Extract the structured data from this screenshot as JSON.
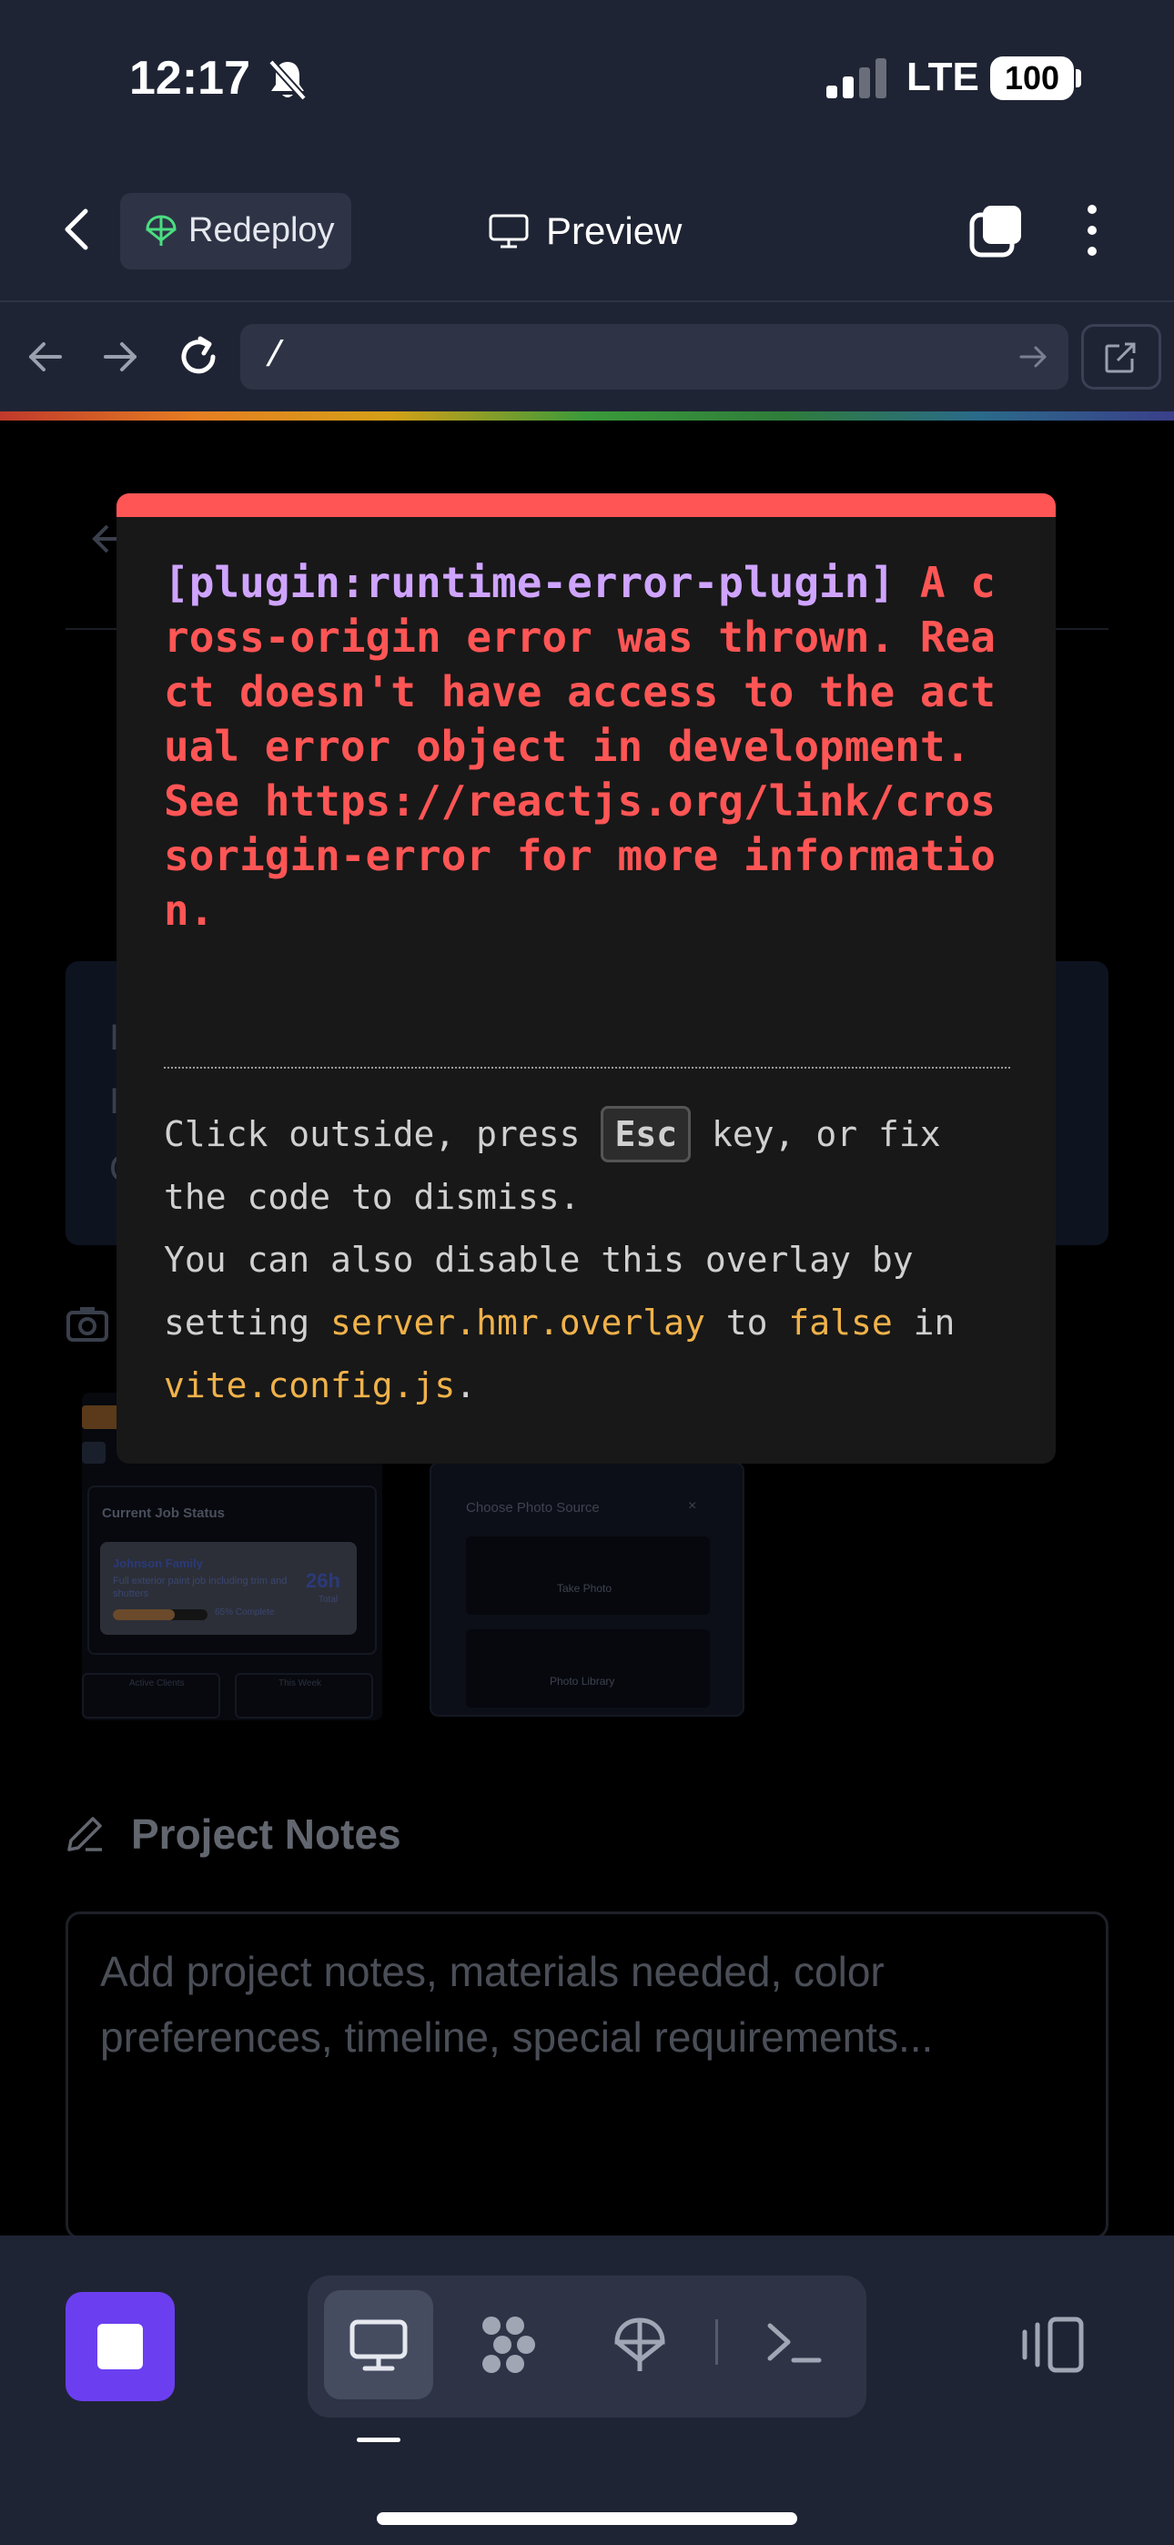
{
  "status_bar": {
    "time": "12:17",
    "network": "LTE",
    "battery": "100"
  },
  "top_nav": {
    "redeploy_label": "Redeploy",
    "preview_label": "Preview"
  },
  "url_bar": {
    "url": "/"
  },
  "error_overlay": {
    "plugin": "[plugin:runtime-error-plugin]",
    "message": " A cross-origin error was thrown. React doesn't have access to the actual error object in development. See https://reactjs.org/link/crossorigin-error for more information.",
    "tip_prefix": "Click outside, press ",
    "tip_key": "Esc",
    "tip_suffix": " key, or fix the code to dismiss.",
    "tip2_prefix": "You can also disable this overlay by setting ",
    "tip2_code1": "server.hmr.overlay",
    "tip2_mid": " to ",
    "tip2_code2": "false",
    "tip2_mid2": " in ",
    "tip2_code3": "vite.config.js",
    "tip2_end": "."
  },
  "page_behind": {
    "card_chars": [
      "I",
      "I",
      "C"
    ],
    "thumbnail_1": {
      "panel_title": "Current Job Status",
      "client_name": "Johnson Family",
      "job_description": "Full exterior paint job including trim and shutters",
      "hours": "26h",
      "hours_label": "Total",
      "progress_label": "65% Complete",
      "progress": 0.65,
      "mini_1": "Active Clients",
      "mini_2": "This Week"
    },
    "thumbnail_2": {
      "title": "Choose Photo Source",
      "close": "×",
      "option_1": "Take Photo",
      "option_2": "Photo Library"
    },
    "project_notes": {
      "title": "Project Notes",
      "placeholder": "Add project notes, materials needed, color preferences, timeline, special requirements..."
    }
  },
  "colors": {
    "overlay_accent": "#ff5555",
    "plugin_color": "#cfa4ff",
    "code_color": "#f0b24a",
    "stop_button": "#6b3ff0",
    "chrome_bg": "#1f2434"
  }
}
